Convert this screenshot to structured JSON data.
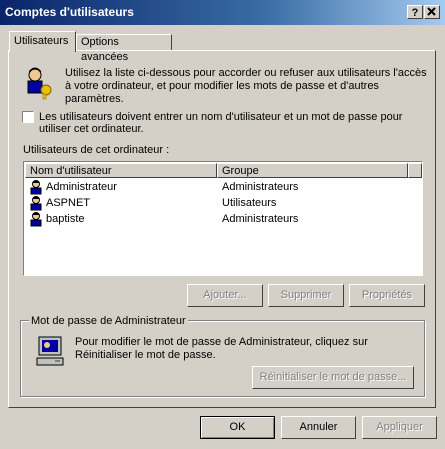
{
  "window": {
    "title": "Comptes d'utilisateurs",
    "help_button": "?",
    "close_button": "X"
  },
  "tabs": [
    {
      "label": "Utilisateurs",
      "active": true
    },
    {
      "label": "Options avancées",
      "active": false
    }
  ],
  "intro": {
    "icon": "users-keys-icon",
    "text_line1": "Utilisez la liste ci-dessous pour accorder ou refuser aux utilisateurs l'accès",
    "text_line2": "à votre ordinateur, et pour modifier les mots de passe et d'autres",
    "text_line3": "paramètres."
  },
  "require_login": {
    "checked": false,
    "label_line1": "Les utilisateurs doivent entrer un nom d'utilisateur et un mot de passe pour",
    "label_line2": "utiliser cet ordinateur."
  },
  "users_list": {
    "heading": "Utilisateurs de cet ordinateur :",
    "columns": [
      "Nom d'utilisateur",
      "Groupe"
    ],
    "rows": [
      {
        "name": "Administrateur",
        "group": "Administrateurs",
        "icon": "user-icon"
      },
      {
        "name": "ASPNET",
        "group": "Utilisateurs",
        "icon": "user-icon"
      },
      {
        "name": "baptiste",
        "group": "Administrateurs",
        "icon": "user-icon"
      }
    ]
  },
  "list_buttons": {
    "add": "Ajouter...",
    "delete": "Supprimer",
    "properties": "Propriétés"
  },
  "admin_password": {
    "group_label": "Mot de passe de Administrateur",
    "icon": "computer-icon",
    "text_line1": "Pour modifier le mot de passe de Administrateur, cliquez sur",
    "text_line2": "Réinitialiser le mot de passe.",
    "reset_button": "Réinitialiser le mot de passe..."
  },
  "footer": {
    "ok": "OK",
    "cancel": "Annuler",
    "apply": "Appliquer"
  }
}
